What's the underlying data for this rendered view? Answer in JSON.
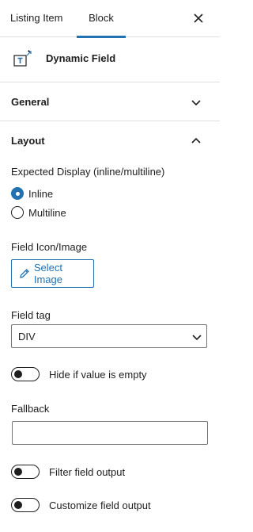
{
  "tabs": [
    {
      "label": "Listing Item"
    },
    {
      "label": "Block"
    }
  ],
  "block": {
    "name": "Dynamic Field",
    "icon": "dynamic-field-icon"
  },
  "panels": {
    "general": {
      "title": "General"
    },
    "layout": {
      "title": "Layout"
    }
  },
  "layout": {
    "expected_display_label": "Expected Display (inline/multiline)",
    "display_options": [
      {
        "label": "Inline",
        "checked": true
      },
      {
        "label": "Multiline",
        "checked": false
      }
    ],
    "field_icon_label": "Field Icon/Image",
    "select_image_label": "Select Image",
    "field_tag_label": "Field tag",
    "field_tag_value": "DIV",
    "hide_if_empty_label": "Hide if value is empty",
    "fallback_label": "Fallback",
    "fallback_value": "",
    "filter_output_label": "Filter field output",
    "customize_output_label": "Customize field output"
  },
  "colors": {
    "accent": "#2271b1",
    "text": "#1e1e1e",
    "border": "#e0e0e0"
  }
}
